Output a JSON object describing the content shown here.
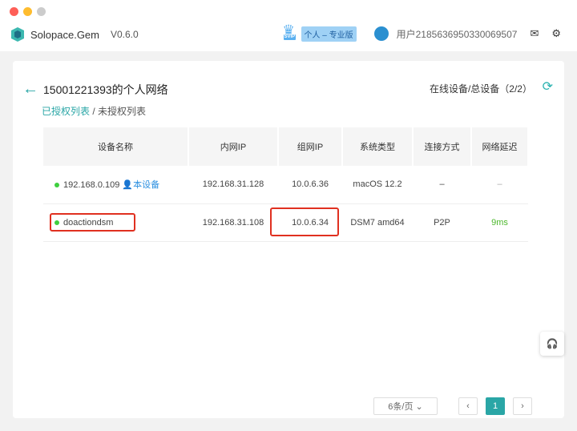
{
  "app": {
    "name": "Solopace.Gem",
    "version": "V0.6.0"
  },
  "header": {
    "vip_badge": "SVIP",
    "plan": "个人 – 专业版",
    "user": "用户2185636950330069507"
  },
  "page": {
    "title": "15001221393的个人网络",
    "online": "在线设备/总设备（2/2）",
    "tab_active": "已授权列表",
    "sep": "/",
    "tab_other": "未授权列表"
  },
  "table": {
    "headers": [
      "设备名称",
      "内网IP",
      "组网IP",
      "系统类型",
      "连接方式",
      "网络延迟"
    ],
    "rows": [
      {
        "name": "192.168.0.109",
        "tag": "本设备",
        "lan": "192.168.31.128",
        "vip": "10.0.6.36",
        "os": "macOS 12.2",
        "conn": "–",
        "lat": "–"
      },
      {
        "name": "doactiondsm",
        "tag": "",
        "lan": "192.168.31.108",
        "vip": "10.0.6.34",
        "os": "DSM7 amd64",
        "conn": "P2P",
        "lat": "9ms"
      }
    ]
  },
  "pager": {
    "size": "6条/页",
    "prev": "‹",
    "page": "1",
    "next": "›"
  }
}
